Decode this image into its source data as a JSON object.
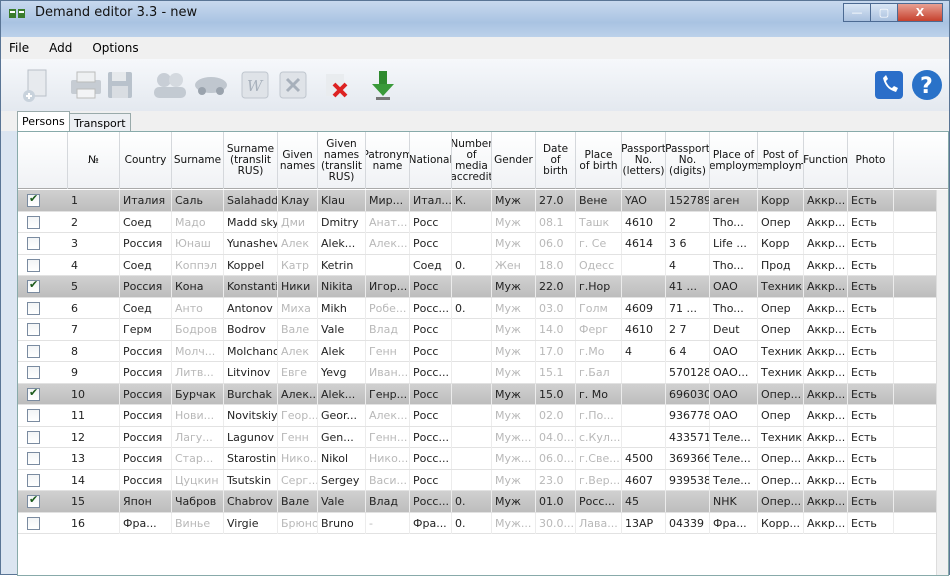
{
  "window": {
    "title": "Demand editor 3.3 - new",
    "minimize": "—",
    "maximize": "▢",
    "close": "X"
  },
  "menu": {
    "file": "File",
    "add": "Add",
    "options": "Options"
  },
  "tabs": {
    "persons": "Persons",
    "transport": "Transport"
  },
  "columns": [
    "",
    "№",
    "Country",
    "Surname",
    "Surname (translit RUS)",
    "Given names",
    "Given names (translit RUS)",
    "Patronym name",
    "National",
    "Number of media accredit",
    "Gender",
    "Date of birth",
    "Place of birth",
    "Passport No. (letters)",
    "Passport No. (digits)",
    "Place of employm",
    "Post of employm",
    "Function",
    "Photo"
  ],
  "rows": [
    {
      "checked": true,
      "sel": true,
      "cells": [
        "1",
        "Италия",
        "Саль",
        "Salahaddzho",
        "Клау",
        "Klau",
        "Мир...",
        "Итал...",
        "К.",
        "Муж",
        "27.0",
        "Вене",
        "YAO",
        "152789",
        "аген",
        "Корр",
        "Аккр...",
        "Есть"
      ]
    },
    {
      "checked": false,
      "sel": false,
      "cells": [
        "2",
        "Соед",
        "Мадо",
        "Madd sky",
        "Дми",
        "Dmitry",
        "Анат...",
        "Росс",
        "",
        "Муж",
        "08.1",
        "Ташк",
        "4610",
        "2",
        "Тho...",
        "Опер",
        "Аккр...",
        "Есть"
      ]
    },
    {
      "checked": false,
      "sel": false,
      "cells": [
        "3",
        "Россия",
        "Юнаш",
        "Yunashev",
        "Алек",
        "Alek...",
        "Алек...",
        "Росс",
        "",
        "Муж",
        "06.0",
        "г. Се",
        "4614",
        "3 6",
        "Life ...",
        "Корр",
        "Аккр...",
        "Есть"
      ]
    },
    {
      "checked": false,
      "sel": false,
      "cells": [
        "4",
        "Соед",
        "Коппэл",
        "Koppel",
        "Катр",
        "Ketrin",
        "",
        "Соед",
        "0.",
        "Жен",
        "18.0",
        "Одесс",
        "",
        "4",
        "Тho...",
        "Прод",
        "Аккр...",
        "Есть"
      ]
    },
    {
      "checked": true,
      "sel": true,
      "cells": [
        "5",
        "Россия",
        "Кона",
        "Konstantin",
        "Ники",
        "Nikita",
        "Игор...",
        "Росс",
        "",
        "Муж",
        "22.0",
        "г.Нор",
        "",
        "41 ...",
        "ОАО",
        "Техник",
        "Аккр...",
        "Есть"
      ]
    },
    {
      "checked": false,
      "sel": false,
      "cells": [
        "6",
        "Соед",
        "Анто",
        "Antonov",
        "Миха",
        "Mikh",
        "Робе...",
        "Росс...",
        "0.",
        "Муж",
        "03.0",
        "Голм",
        "4609",
        "71 ...",
        "Тho...",
        "Опер",
        "Аккр...",
        "Есть"
      ]
    },
    {
      "checked": false,
      "sel": false,
      "cells": [
        "7",
        "Герм",
        "Бодров",
        "Bodrov",
        "Вале",
        "Vale",
        "Влад",
        "Росс",
        "",
        "Муж",
        "14.0",
        "Ферг",
        "4610",
        "2 7",
        "Deut",
        "Опер",
        "Аккр...",
        "Есть"
      ]
    },
    {
      "checked": false,
      "sel": false,
      "cells": [
        "8",
        "Россия",
        "Молч...",
        "Molchanov",
        "Алек",
        "Alek",
        "Генн",
        "Росс",
        "",
        "Муж",
        "17.0",
        "г.Мо",
        "4",
        "6 4",
        "ОАО",
        "Техник",
        "Аккр...",
        "Есть"
      ]
    },
    {
      "checked": false,
      "sel": false,
      "cells": [
        "9",
        "Россия",
        "Литв...",
        "Litvinov",
        "Евге",
        "Yevg",
        "Иван...",
        "Росс...",
        "",
        "Муж",
        "15.1",
        "г.Бал",
        "",
        "570128",
        "ОАО...",
        "Техник",
        "Аккр...",
        "Есть"
      ]
    },
    {
      "checked": true,
      "sel": true,
      "cells": [
        "10",
        "Россия",
        "Бурчак",
        "Burchak",
        "Алек...",
        "Alek...",
        "Генр...",
        "Росс",
        "",
        "Муж",
        "15.0",
        "г. Мо",
        "",
        "696030",
        "ОАО",
        "Опер...",
        "Аккр...",
        "Есть"
      ]
    },
    {
      "checked": false,
      "sel": false,
      "cells": [
        "11",
        "Россия",
        "Нови...",
        "Novitskiy",
        "Геор...",
        "Geor...",
        "Алек...",
        "Росс",
        "",
        "Муж",
        "02.0",
        "г.По...",
        "",
        "936778",
        "ОАО",
        "Опер",
        "Аккр...",
        "Есть"
      ]
    },
    {
      "checked": false,
      "sel": false,
      "cells": [
        "12",
        "Россия",
        "Лагу...",
        "Lagunov",
        "Генн",
        "Gen...",
        "Генн...",
        "Росс...",
        "",
        "Муж...",
        "04.0...",
        "с.Кул...",
        "",
        "433571",
        "Теле...",
        "Техник",
        "Аккр...",
        "Есть"
      ]
    },
    {
      "checked": false,
      "sel": false,
      "cells": [
        "13",
        "Россия",
        "Стар...",
        "Starostin",
        "Нико...",
        "Nikol",
        "Нико...",
        "Росс...",
        "",
        "Муж...",
        "06.0...",
        "г.Све...",
        "4500",
        "369366",
        "Теле...",
        "Опер...",
        "Аккр...",
        "Есть"
      ]
    },
    {
      "checked": false,
      "sel": false,
      "cells": [
        "14",
        "Россия",
        "Цуцкин",
        "Tsutskin",
        "Серг...",
        "Sergey",
        "Васи...",
        "Росс",
        "",
        "Муж",
        "23.0",
        "г.Вер...",
        "4607",
        "939538",
        "Теле...",
        "Опер...",
        "Аккр...",
        "Есть"
      ]
    },
    {
      "checked": true,
      "sel": true,
      "cells": [
        "15",
        "Япон",
        "Чабров",
        "Chabrov",
        "Вале",
        "Vale",
        "Влад",
        "Росс...",
        "0.",
        "Муж",
        "01.0",
        "Росс...",
        "45",
        "",
        "NHK",
        "Опер...",
        "Аккр...",
        "Есть"
      ]
    },
    {
      "checked": false,
      "sel": false,
      "cells": [
        "16",
        "Фра...",
        "Винье",
        "Virgie",
        "Брюно",
        "Bruno",
        "-",
        "Фра...",
        "0.",
        "Муж...",
        "30.0...",
        "Лава...",
        "13АР",
        "04339",
        "Фра...",
        "Корр...",
        "Аккр...",
        "Есть"
      ]
    }
  ]
}
